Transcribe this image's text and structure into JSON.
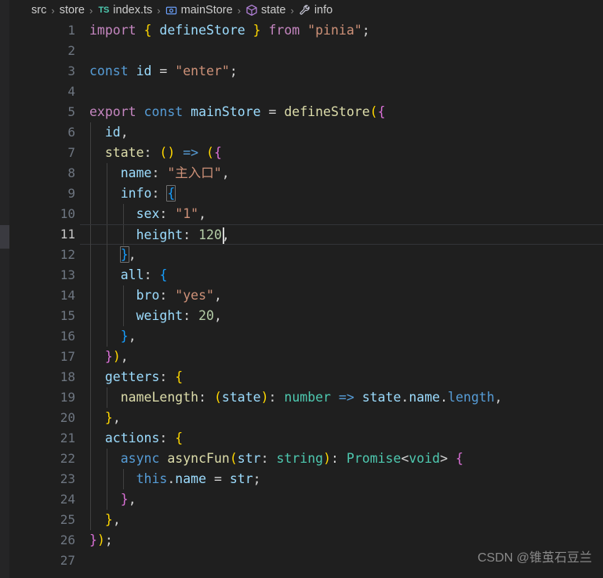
{
  "window": {
    "theme": "dark",
    "background": "#1f1f1f",
    "editor_background": "#1f1f1f",
    "active_line_border": "#333438",
    "line_number_color": "#6e7681",
    "active_line_number_color": "#c6c6c6"
  },
  "breadcrumb": {
    "items": [
      {
        "label": "src",
        "icon": ""
      },
      {
        "label": "store",
        "icon": ""
      },
      {
        "label": "index.ts",
        "icon": "typescript-file-icon"
      },
      {
        "label": "mainStore",
        "icon": "module-icon"
      },
      {
        "label": "state",
        "icon": "cube-icon"
      },
      {
        "label": "info",
        "icon": "wrench-icon"
      }
    ],
    "separator": "›",
    "ts_badge_text": "TS",
    "module_badge_text": "[ø]"
  },
  "editor": {
    "language": "typescript",
    "active_line": 11,
    "cursor_line": 11,
    "cursor_column": 17,
    "total_visible_lines": 27,
    "lines": [
      {
        "n": "1",
        "text": "import { defineStore } from \"pinia\";"
      },
      {
        "n": "2",
        "text": ""
      },
      {
        "n": "3",
        "text": "const id = \"enter\";"
      },
      {
        "n": "4",
        "text": ""
      },
      {
        "n": "5",
        "text": "export const mainStore = defineStore({"
      },
      {
        "n": "6",
        "text": "  id,"
      },
      {
        "n": "7",
        "text": "  state: () => ({"
      },
      {
        "n": "8",
        "text": "    name: \"主入口\","
      },
      {
        "n": "9",
        "text": "    info: {"
      },
      {
        "n": "10",
        "text": "      sex: \"1\","
      },
      {
        "n": "11",
        "text": "      height: 120,"
      },
      {
        "n": "12",
        "text": "    },"
      },
      {
        "n": "13",
        "text": "    all: {"
      },
      {
        "n": "14",
        "text": "      bro: \"yes\","
      },
      {
        "n": "15",
        "text": "      weight: 20,"
      },
      {
        "n": "16",
        "text": "    },"
      },
      {
        "n": "17",
        "text": "  }),"
      },
      {
        "n": "18",
        "text": "  getters: {"
      },
      {
        "n": "19",
        "text": "    nameLength: (state): number => state.name.length,"
      },
      {
        "n": "20",
        "text": "  },"
      },
      {
        "n": "21",
        "text": "  actions: {"
      },
      {
        "n": "22",
        "text": "    async asyncFun(str: string): Promise<void> {"
      },
      {
        "n": "23",
        "text": "      this.name = str;"
      },
      {
        "n": "24",
        "text": "    },"
      },
      {
        "n": "25",
        "text": "  },"
      },
      {
        "n": "26",
        "text": "});"
      },
      {
        "n": "27",
        "text": ""
      }
    ],
    "bracket_match": {
      "open_line": 9,
      "open_char": "{",
      "close_line": 12,
      "close_char": "}"
    }
  },
  "syntax_colors": {
    "keyword_control": "#c586c0",
    "keyword": "#569cd6",
    "variable": "#9cdcfe",
    "function": "#dcdcaa",
    "string": "#ce9178",
    "number": "#b5cea8",
    "type": "#4ec9b0",
    "punctuation": "#d4d4d4",
    "bracket_yellow": "#ffd700",
    "bracket_purple": "#da70d6",
    "bracket_blue": "#179fff"
  },
  "watermark": {
    "text": "CSDN @锥茧石豆兰"
  }
}
